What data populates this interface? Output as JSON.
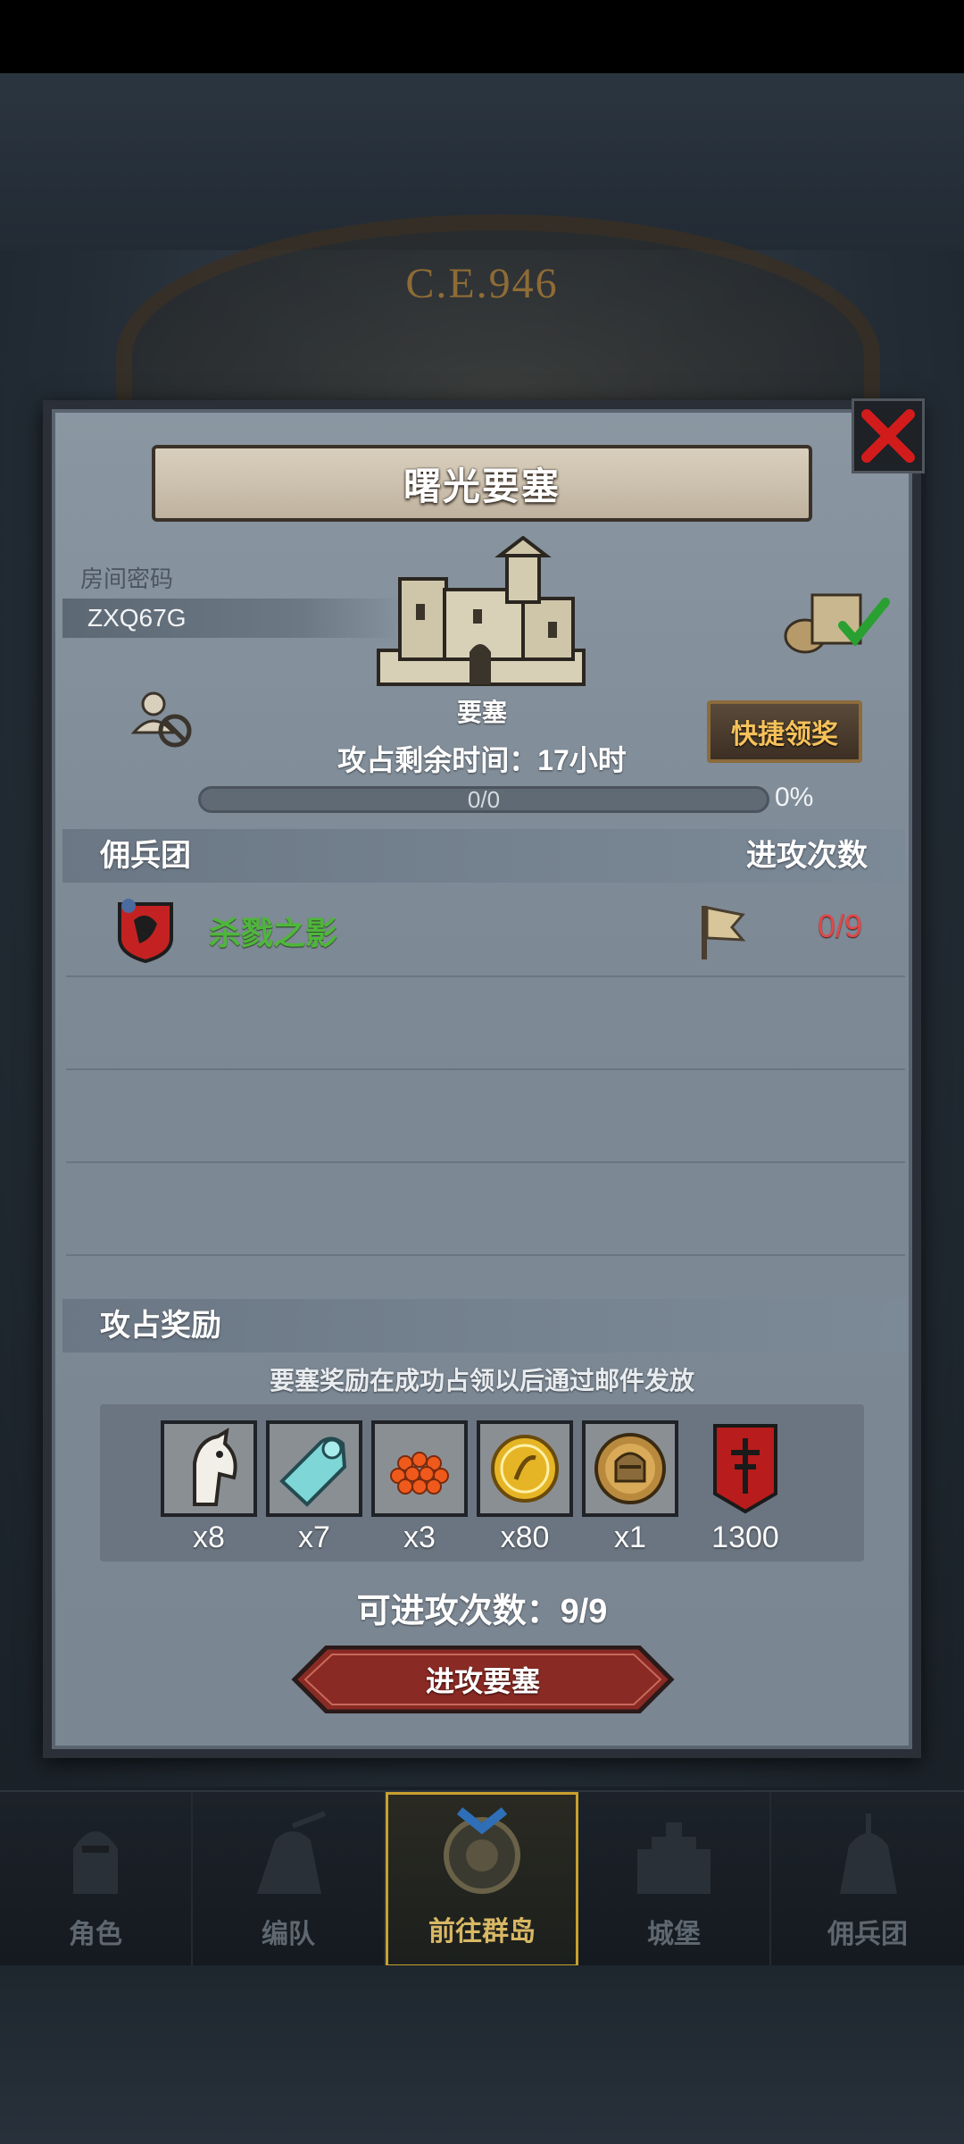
{
  "background": {
    "year_text": "C.E.946"
  },
  "dialog": {
    "title": "曙光要塞",
    "room_label": "房间密码",
    "room_code": "ZXQ67G",
    "building_label": "要塞",
    "quick_claim_label": "快捷领奖",
    "time_text": "攻占剩余时间：17小时",
    "progress": {
      "text": "0/0",
      "percent_text": "0%",
      "fraction": 0
    },
    "mercenary_header": "佣兵团",
    "attacks_header": "进攻次数",
    "mercenaries": [
      {
        "name": "杀戮之影",
        "count": "0/9"
      }
    ],
    "reward_header": "攻占奖励",
    "reward_note": "要塞奖励在成功占领以后通过邮件发放",
    "rewards": [
      {
        "icon": "horse-icon",
        "qty": "x8"
      },
      {
        "icon": "cloth-icon",
        "qty": "x7"
      },
      {
        "icon": "fish-eggs-icon",
        "qty": "x3"
      },
      {
        "icon": "gold-coin-icon",
        "qty": "x80"
      },
      {
        "icon": "knight-medal-icon",
        "qty": "x1"
      },
      {
        "icon": "banner-icon",
        "qty": "1300"
      }
    ],
    "attacks_left": "可进攻次数：9/9",
    "attack_button": "进攻要塞"
  },
  "nav": [
    {
      "label": "角色",
      "icon": "knight-icon",
      "active": false
    },
    {
      "label": "编队",
      "icon": "formation-icon",
      "active": false
    },
    {
      "label": "前往群岛",
      "icon": "compass-icon",
      "active": true
    },
    {
      "label": "城堡",
      "icon": "castle-icon",
      "active": false
    },
    {
      "label": "佣兵团",
      "icon": "mercenary-icon",
      "active": false
    }
  ],
  "colors": {
    "accent_gold": "#c8a02e",
    "name_green": "#4fb63b",
    "count_red": "#e04848"
  }
}
